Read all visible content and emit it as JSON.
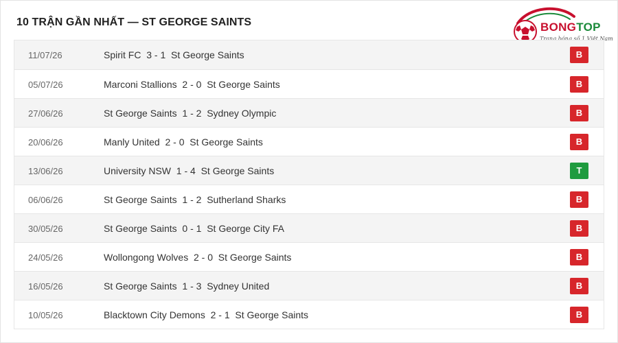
{
  "header": {
    "title": "10 TRẬN GẦN NHẤT — ST GEORGE SAINTS"
  },
  "logo": {
    "part1": "BONG",
    "part2": "TOP",
    "tagline": "Trang bóng số 1 Việt Nam"
  },
  "colors": {
    "loss": "#d7262b",
    "win": "#1f9b3f",
    "brand_red": "#c8102e",
    "brand_green": "#1a8a3a"
  },
  "matches": [
    {
      "date": "11/07/26",
      "home": "Spirit FC",
      "score": "3 - 1",
      "away": "St George Saints",
      "result": "B",
      "result_type": "loss"
    },
    {
      "date": "05/07/26",
      "home": "Marconi Stallions",
      "score": "2 - 0",
      "away": "St George Saints",
      "result": "B",
      "result_type": "loss"
    },
    {
      "date": "27/06/26",
      "home": "St George Saints",
      "score": "1 - 2",
      "away": "Sydney Olympic",
      "result": "B",
      "result_type": "loss"
    },
    {
      "date": "20/06/26",
      "home": "Manly United",
      "score": "2 - 0",
      "away": "St George Saints",
      "result": "B",
      "result_type": "loss"
    },
    {
      "date": "13/06/26",
      "home": "University NSW",
      "score": "1 - 4",
      "away": "St George Saints",
      "result": "T",
      "result_type": "win"
    },
    {
      "date": "06/06/26",
      "home": "St George Saints",
      "score": "1 - 2",
      "away": "Sutherland Sharks",
      "result": "B",
      "result_type": "loss"
    },
    {
      "date": "30/05/26",
      "home": "St George Saints",
      "score": "0 - 1",
      "away": "St George City FA",
      "result": "B",
      "result_type": "loss"
    },
    {
      "date": "24/05/26",
      "home": "Wollongong Wolves",
      "score": "2 - 0",
      "away": "St George Saints",
      "result": "B",
      "result_type": "loss"
    },
    {
      "date": "16/05/26",
      "home": "St George Saints",
      "score": "1 - 3",
      "away": "Sydney United",
      "result": "B",
      "result_type": "loss"
    },
    {
      "date": "10/05/26",
      "home": "Blacktown City Demons",
      "score": "2 - 1",
      "away": "St George Saints",
      "result": "B",
      "result_type": "loss"
    }
  ]
}
